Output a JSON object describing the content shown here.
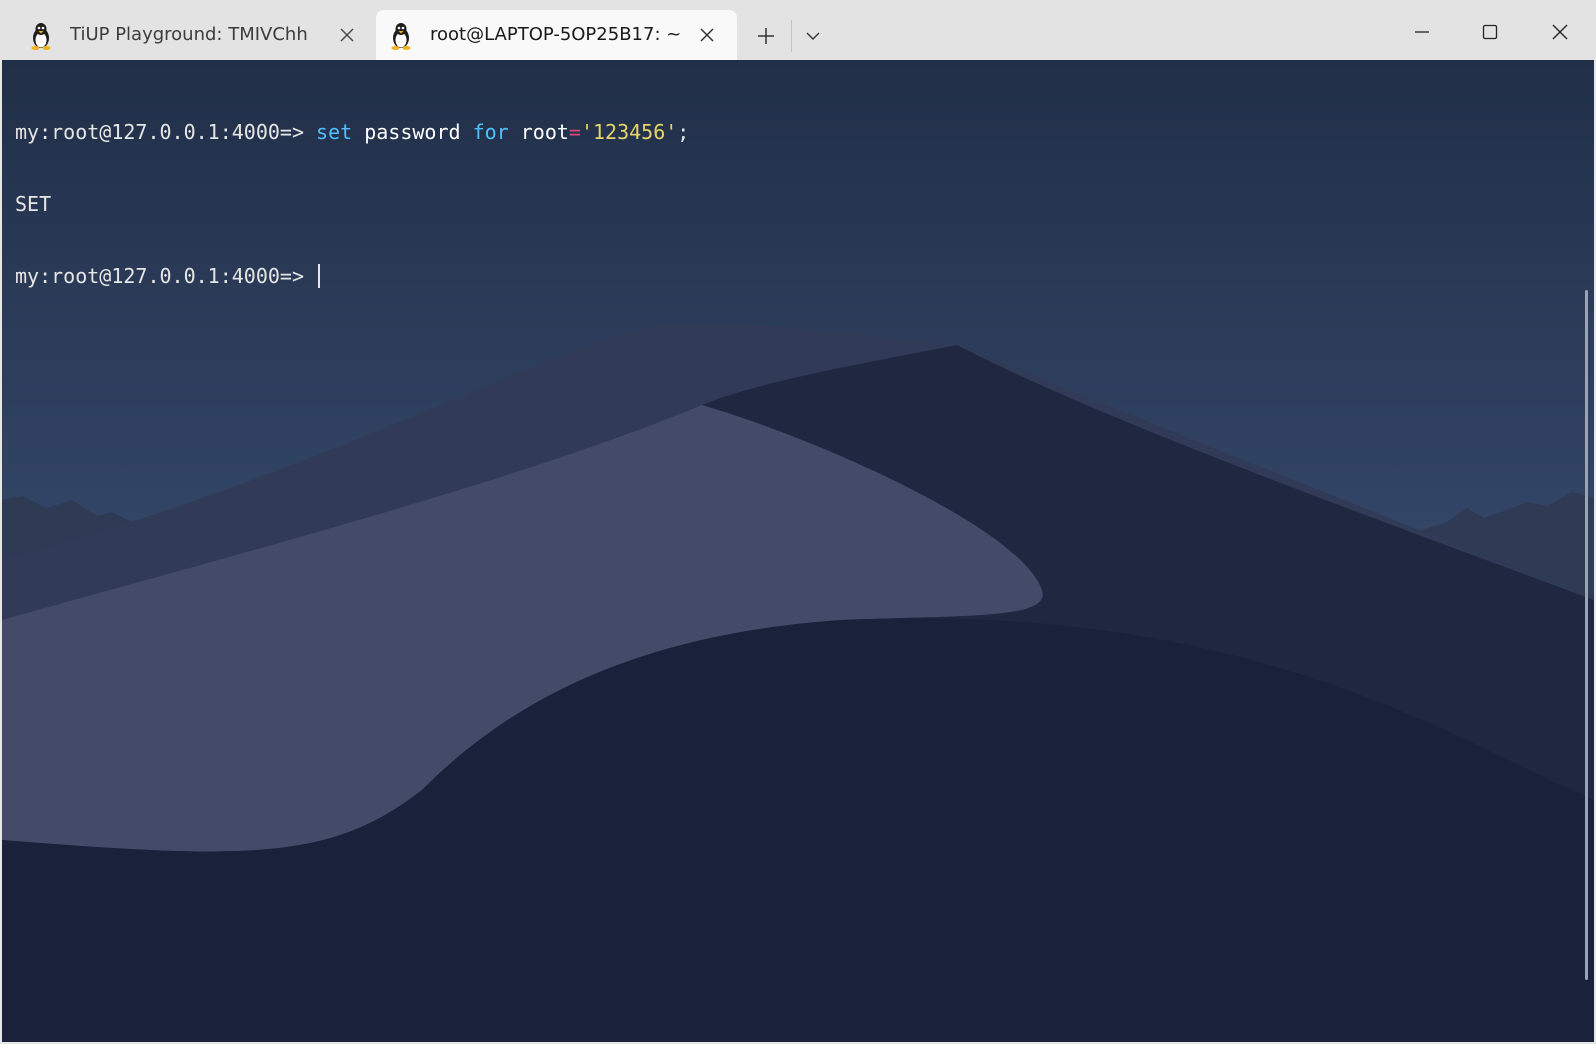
{
  "tabs": [
    {
      "label": "TiUP Playground: TMIVChh",
      "icon": "linux-tux-icon",
      "active": false
    },
    {
      "label": "root@LAPTOP-5OP25B17: ~",
      "icon": "linux-tux-icon",
      "active": true
    }
  ],
  "toolbar": {
    "new_tab_icon": "plus-icon",
    "dropdown_icon": "chevron-down-icon"
  },
  "window_controls": {
    "minimize_icon": "minimize-icon",
    "maximize_icon": "maximize-icon",
    "close_icon": "close-icon"
  },
  "terminal": {
    "line1": {
      "prompt": "my:root@127.0.0.1:4000=> ",
      "cmd_set": "set",
      "sp1": " ",
      "cmd_password": "password",
      "sp2": " ",
      "cmd_for": "for",
      "sp3": " ",
      "cmd_root": "root",
      "cmd_eq": "=",
      "cmd_str": "'123456'",
      "cmd_semi": ";"
    },
    "line2": "SET",
    "line3_prompt": "my:root@127.0.0.1:4000=> "
  },
  "colors": {
    "keyword": "#4fc1ff",
    "identifier": "#ffffff",
    "operator": "#e0457b",
    "string": "#e5d56b",
    "text": "#e6e6e6",
    "background_top": "#223049"
  }
}
